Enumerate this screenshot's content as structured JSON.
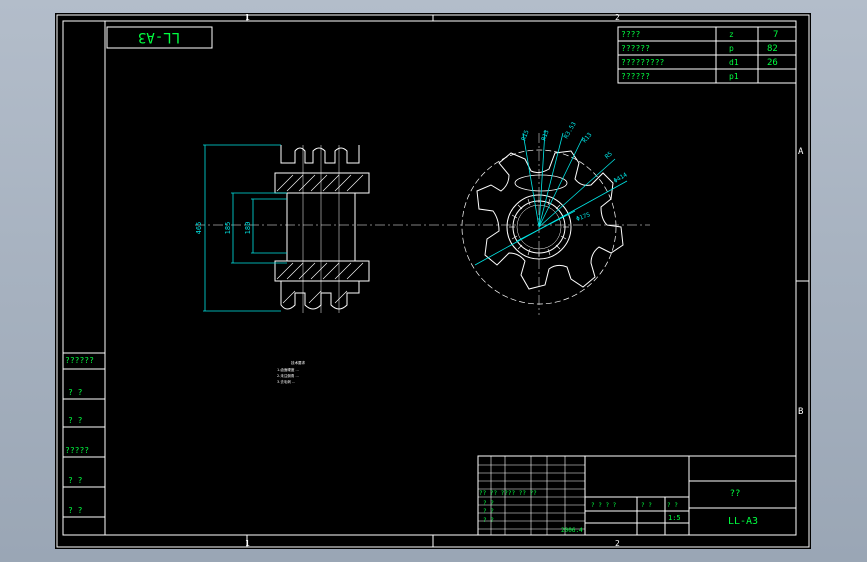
{
  "drawing": {
    "stamp_label": "LL-A3",
    "zone_top": [
      "1",
      "2"
    ],
    "zone_bottom": [
      "1",
      "2"
    ],
    "zone_right": [
      "A",
      "B"
    ]
  },
  "params": [
    {
      "name": "????",
      "symbol": "z",
      "value": "7"
    },
    {
      "name": "??????",
      "symbol": "p",
      "value": "82"
    },
    {
      "name": "?????????",
      "symbol": "d1",
      "value": "26"
    },
    {
      "name": "??????",
      "symbol": "p1",
      "value": ""
    }
  ],
  "left_strip": [
    "??????",
    "?  ?",
    "?  ?",
    "?????",
    "?  ?",
    "?  ?"
  ],
  "dims_side": {
    "overall_height": "465",
    "hub_height": "185",
    "bore": "180"
  },
  "dims_front": {
    "r1": "R15",
    "r2": "R13",
    "r3": "R3.53",
    "r4": "R13",
    "r5": "R5",
    "d_pitch": "Φ414",
    "d_bore": "Φ175"
  },
  "notes": [
    "技术要求",
    "1.齿面硬度 ...",
    "2.未注倒角 ...",
    "3.去毛刺 ..."
  ],
  "title_block": {
    "name": "??",
    "code": "LL-A3",
    "scale": "1:5",
    "rows": [
      "?? ??  ????  ??  ??",
      "? ?",
      "? ?",
      "? ?"
    ],
    "mid": [
      "? ? ? ?",
      "?  ?",
      "?  ?"
    ],
    "date": "2006.4"
  }
}
